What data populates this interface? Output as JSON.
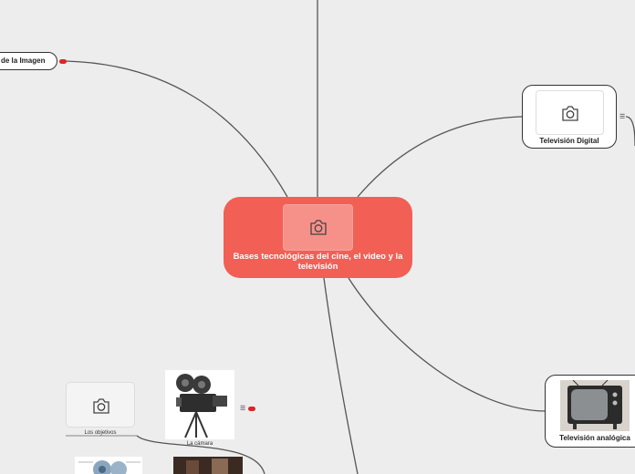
{
  "central": {
    "title": "Bases tecnológicas del cine, el video y la televisión"
  },
  "nodes": {
    "imagen": {
      "label": "de la Imagen"
    },
    "tv_digital": {
      "label": "Televisión Digital"
    },
    "tv_analogica": {
      "label": "Televisión analógica"
    },
    "objetivos": {
      "label": "Los objetivos"
    },
    "camara": {
      "label": "La cámara"
    }
  },
  "icons": {
    "placeholder": "camera-icon",
    "notes": "list-icon",
    "marker": "red-dot"
  },
  "colors": {
    "background": "#ededed",
    "central": "#f15f55",
    "central_photo": "#f6918a",
    "marker": "#e02424",
    "line": "#444444"
  }
}
